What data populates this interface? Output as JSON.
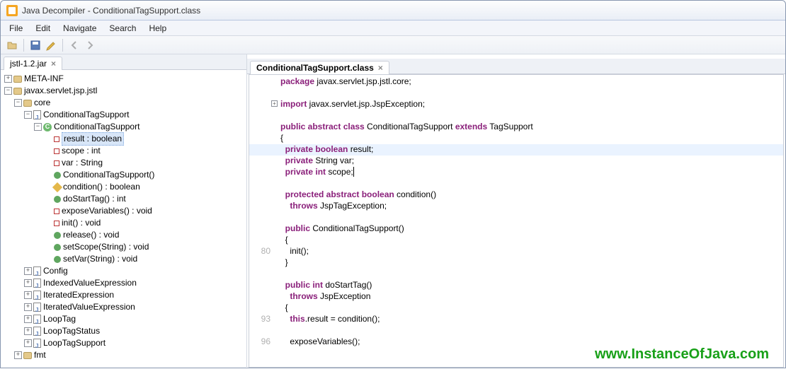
{
  "window": {
    "title": "Java Decompiler - ConditionalTagSupport.class"
  },
  "menus": {
    "file": "File",
    "edit": "Edit",
    "navigate": "Navigate",
    "search": "Search",
    "help": "Help"
  },
  "nav_tab": {
    "label": "jstl-1.2.jar"
  },
  "tree": {
    "metainf": "META-INF",
    "pkg_root": "javax.servlet.jsp.jstl",
    "core": "core",
    "cls_file": "ConditionalTagSupport",
    "cls": "ConditionalTagSupport",
    "members": {
      "result": "result : boolean",
      "scope": "scope : int",
      "var": "var : String",
      "ctor": "ConditionalTagSupport()",
      "condition": "condition() : boolean",
      "doStartTag": "doStartTag() : int",
      "exposeVariables": "exposeVariables() : void",
      "init": "init() : void",
      "release": "release() : void",
      "setScope": "setScope(String) : void",
      "setVar": "setVar(String) : void"
    },
    "siblings": {
      "config": "Config",
      "ive": "IndexedValueExpression",
      "ite": "IteratedExpression",
      "itve": "IteratedValueExpression",
      "looptag": "LoopTag",
      "loopstatus": "LoopTagStatus",
      "loopsupport": "LoopTagSupport"
    },
    "fmt": "fmt"
  },
  "editor_tab": {
    "label": "ConditionalTagSupport.class"
  },
  "code": {
    "pkg_kw": "package",
    "pkg_rest": " javax.servlet.jsp.jstl.core;",
    "imp_kw": "import",
    "imp_rest": " javax.servlet.jsp.JspException;",
    "decl_pre": "public abstract class",
    "decl_mid": " ConditionalTagSupport ",
    "decl_ext": "extends",
    "decl_post": " TagSupport",
    "lbrace": "{",
    "f1a": "  ",
    "f1b": "private boolean",
    "f1c": " result;",
    "f2a": "  ",
    "f2b": "private",
    "f2c": " String var;",
    "f3a": "  ",
    "f3b": "private int",
    "f3c": " scope;",
    "m1a": "  ",
    "m1b": "protected abstract boolean",
    "m1c": " condition()",
    "m1t": "    ",
    "m1tb": "throws",
    "m1tc": " JspTagException;",
    "m2a": "  ",
    "m2b": "public",
    "m2c": " ConditionalTagSupport()",
    "m2lb": "  {",
    "m2body": "    init();",
    "m2rb": "  }",
    "m3a": "  ",
    "m3b": "public int",
    "m3c": " doStartTag()",
    "m3t": "    ",
    "m3tb": "throws",
    "m3tc": " JspException",
    "m3lb": "  {",
    "m3body_a": "    ",
    "m3body_b": "this",
    "m3body_c": ".result = condition();",
    "m4body": "    exposeVariables();",
    "ln80": "80",
    "ln93": "93",
    "ln96": "96"
  },
  "watermark": "www.InstanceOfJava.com"
}
